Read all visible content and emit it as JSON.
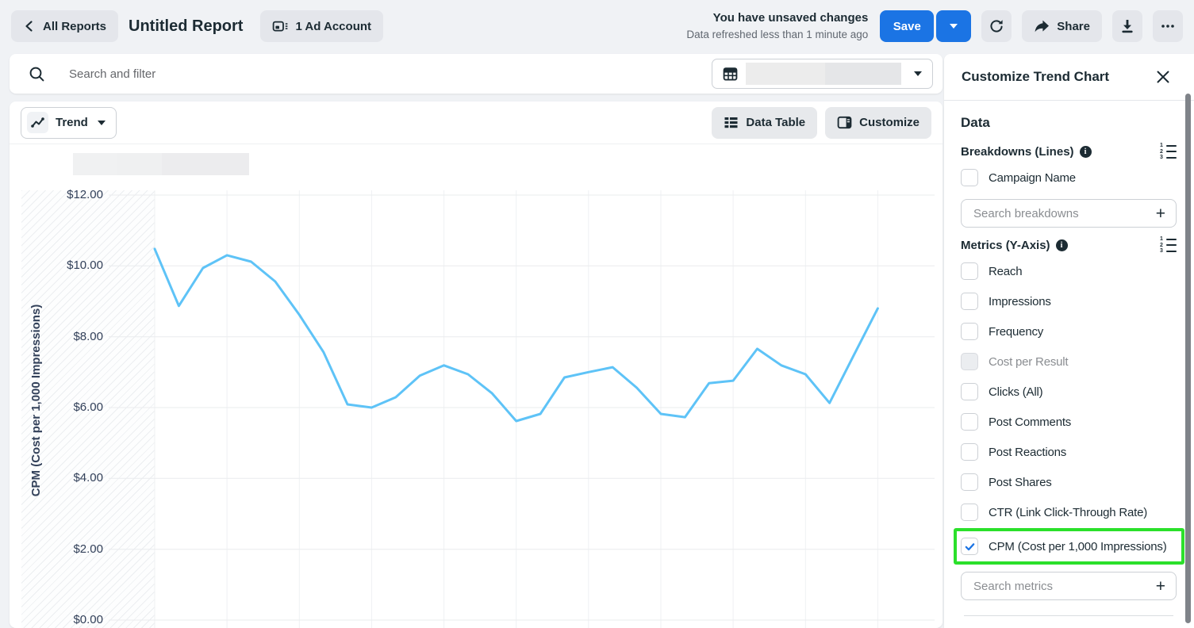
{
  "topbar": {
    "back_label": "All Reports",
    "title": "Untitled Report",
    "ad_account_label": "1 Ad Account",
    "unsaved_text": "You have unsaved changes",
    "refreshed_text": "Data refreshed less than 1 minute ago",
    "save_label": "Save",
    "share_label": "Share"
  },
  "search_bar": {
    "placeholder": "Search and filter"
  },
  "chart_toolbar": {
    "view_label": "Trend",
    "data_table_label": "Data Table",
    "customize_label": "Customize"
  },
  "sidebar": {
    "title": "Customize Trend Chart",
    "section_data": "Data",
    "breakdowns": {
      "heading": "Breakdowns (Lines)",
      "items": [
        {
          "label": "Campaign Name",
          "checked": false,
          "disabled": false
        }
      ],
      "search_placeholder": "Search breakdowns"
    },
    "metrics": {
      "heading": "Metrics (Y-Axis)",
      "items": [
        {
          "label": "Reach",
          "checked": false,
          "disabled": false
        },
        {
          "label": "Impressions",
          "checked": false,
          "disabled": false
        },
        {
          "label": "Frequency",
          "checked": false,
          "disabled": false
        },
        {
          "label": "Cost per Result",
          "checked": false,
          "disabled": true
        },
        {
          "label": "Clicks (All)",
          "checked": false,
          "disabled": false
        },
        {
          "label": "Post Comments",
          "checked": false,
          "disabled": false
        },
        {
          "label": "Post Reactions",
          "checked": false,
          "disabled": false
        },
        {
          "label": "Post Shares",
          "checked": false,
          "disabled": false
        },
        {
          "label": "CTR (Link Click-Through Rate)",
          "checked": false,
          "disabled": false
        },
        {
          "label": "CPM (Cost per 1,000 Impressions)",
          "checked": true,
          "disabled": false,
          "highlighted": true
        }
      ],
      "search_placeholder": "Search metrics"
    }
  },
  "icons": {
    "plus": "+",
    "numbered_list_digits": [
      "1",
      "2",
      "3"
    ]
  },
  "colors": {
    "accent_blue": "#1b74e4",
    "line_blue": "#5ec3f7",
    "highlight_green": "#2be02b",
    "gridline": "#eaecee",
    "axis_text": "#33415a"
  },
  "chart_data": {
    "type": "line",
    "title": "",
    "xlabel": "",
    "ylabel": "CPM (Cost per 1,000 Impressions)",
    "ylim": [
      0,
      12
    ],
    "y_ticks": [
      "$0.00",
      "$2.00",
      "$4.00",
      "$6.00",
      "$8.00",
      "$10.00",
      "$12.00"
    ],
    "grid": true,
    "legend_position": "top-left-redacted",
    "no_data_hatch_band_left": true,
    "series": [
      {
        "name": "CPM (Cost per 1,000 Impressions)",
        "values": [
          10.48,
          8.87,
          9.94,
          10.3,
          10.12,
          9.56,
          8.62,
          7.57,
          6.09,
          6.0,
          6.29,
          6.9,
          7.19,
          6.94,
          6.4,
          5.62,
          5.82,
          6.85,
          7.0,
          7.14,
          6.56,
          5.82,
          5.73,
          6.69,
          6.76,
          7.66,
          7.19,
          6.94,
          6.13,
          7.47,
          8.8
        ]
      }
    ]
  }
}
